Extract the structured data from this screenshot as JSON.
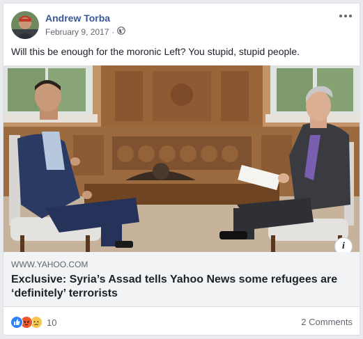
{
  "post": {
    "author": "Andrew Torba",
    "date": "February 9, 2017",
    "separator": "·",
    "privacy_icon": "globe-icon",
    "text": "Will this be enough for the moronic Left? You stupid, stupid people."
  },
  "link": {
    "domain": "WWW.YAHOO.COM",
    "headline": "Exclusive: Syria’s Assad tells Yahoo News some refugees are ‘definitely’ terrorists",
    "info_icon": "i"
  },
  "footer": {
    "reaction_icons": [
      "like-icon",
      "angry-icon",
      "sad-icon"
    ],
    "reaction_count": "10",
    "comments": "2 Comments"
  },
  "colors": {
    "author": "#385898",
    "link_box": "#f2f3f5",
    "like": "#2e81f6",
    "angry": "#f0582c",
    "sad": "#f7c64e"
  }
}
